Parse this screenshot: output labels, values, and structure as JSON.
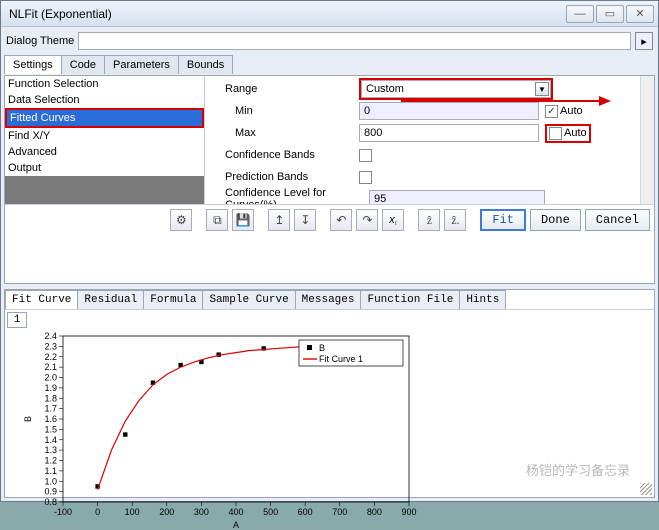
{
  "window": {
    "title": "NLFit (Exponential)"
  },
  "dialog_theme_label": "Dialog Theme",
  "top_tabs": [
    "Settings",
    "Code",
    "Parameters",
    "Bounds"
  ],
  "top_tab_active": 0,
  "side_items": [
    "Function Selection",
    "Data Selection",
    "Fitted Curves",
    "Find X/Y",
    "Advanced",
    "Output"
  ],
  "side_selected": 2,
  "form": {
    "range_label": "Range",
    "range_value": "Custom",
    "min_label": "Min",
    "min_value": "0",
    "min_auto_label": "Auto",
    "min_auto_checked": true,
    "max_label": "Max",
    "max_value": "800",
    "max_auto_label": "Auto",
    "max_auto_checked": false,
    "conf_bands_label": "Confidence Bands",
    "conf_bands_checked": false,
    "pred_bands_label": "Prediction Bands",
    "pred_bands_checked": false,
    "conf_level_label": "Confidence Level for Curves(%)",
    "conf_level_value": "95"
  },
  "toolbar_icons": [
    "gear",
    "copy",
    "save",
    "up",
    "down",
    "undo",
    "redo",
    "xr",
    "z1",
    "z2"
  ],
  "buttons": {
    "fit": "Fit",
    "done": "Done",
    "cancel": "Cancel"
  },
  "lower_tabs": [
    "Fit Curve",
    "Residual",
    "Formula",
    "Sample Curve",
    "Messages",
    "Function File",
    "Hints"
  ],
  "lower_tab_active": 0,
  "plot_tab": "1",
  "legend": {
    "series_b": "B",
    "fit_curve": "Fit Curve 1"
  },
  "axes": {
    "x_label": "A",
    "y_label": "B"
  },
  "watermark": "杨铠的学习备忘录",
  "chart_data": {
    "type": "scatter+line",
    "xlabel": "A",
    "ylabel": "B",
    "xlim": [
      -100,
      900
    ],
    "ylim": [
      0.8,
      2.4
    ],
    "x_ticks": [
      -100,
      0,
      100,
      200,
      300,
      400,
      500,
      600,
      700,
      800,
      900
    ],
    "y_ticks": [
      0.8,
      0.9,
      1.0,
      1.1,
      1.2,
      1.3,
      1.4,
      1.5,
      1.6,
      1.7,
      1.8,
      1.9,
      2.0,
      2.1,
      2.2,
      2.3,
      2.4
    ],
    "series": [
      {
        "name": "B",
        "type": "scatter",
        "x": [
          0,
          80,
          160,
          240,
          300,
          350,
          480,
          800
        ],
        "y": [
          0.95,
          1.45,
          1.95,
          2.12,
          2.15,
          2.22,
          2.28,
          2.32
        ]
      },
      {
        "name": "Fit Curve 1",
        "type": "line",
        "x": [
          0,
          40,
          80,
          120,
          160,
          200,
          240,
          280,
          320,
          360,
          400,
          440,
          480,
          520,
          560,
          600,
          640,
          680,
          720,
          760,
          800
        ],
        "y": [
          0.92,
          1.3,
          1.58,
          1.78,
          1.93,
          2.03,
          2.1,
          2.15,
          2.19,
          2.22,
          2.24,
          2.26,
          2.27,
          2.28,
          2.29,
          2.3,
          2.3,
          2.31,
          2.31,
          2.31,
          2.32
        ]
      }
    ],
    "legend_pos": "top-right"
  }
}
